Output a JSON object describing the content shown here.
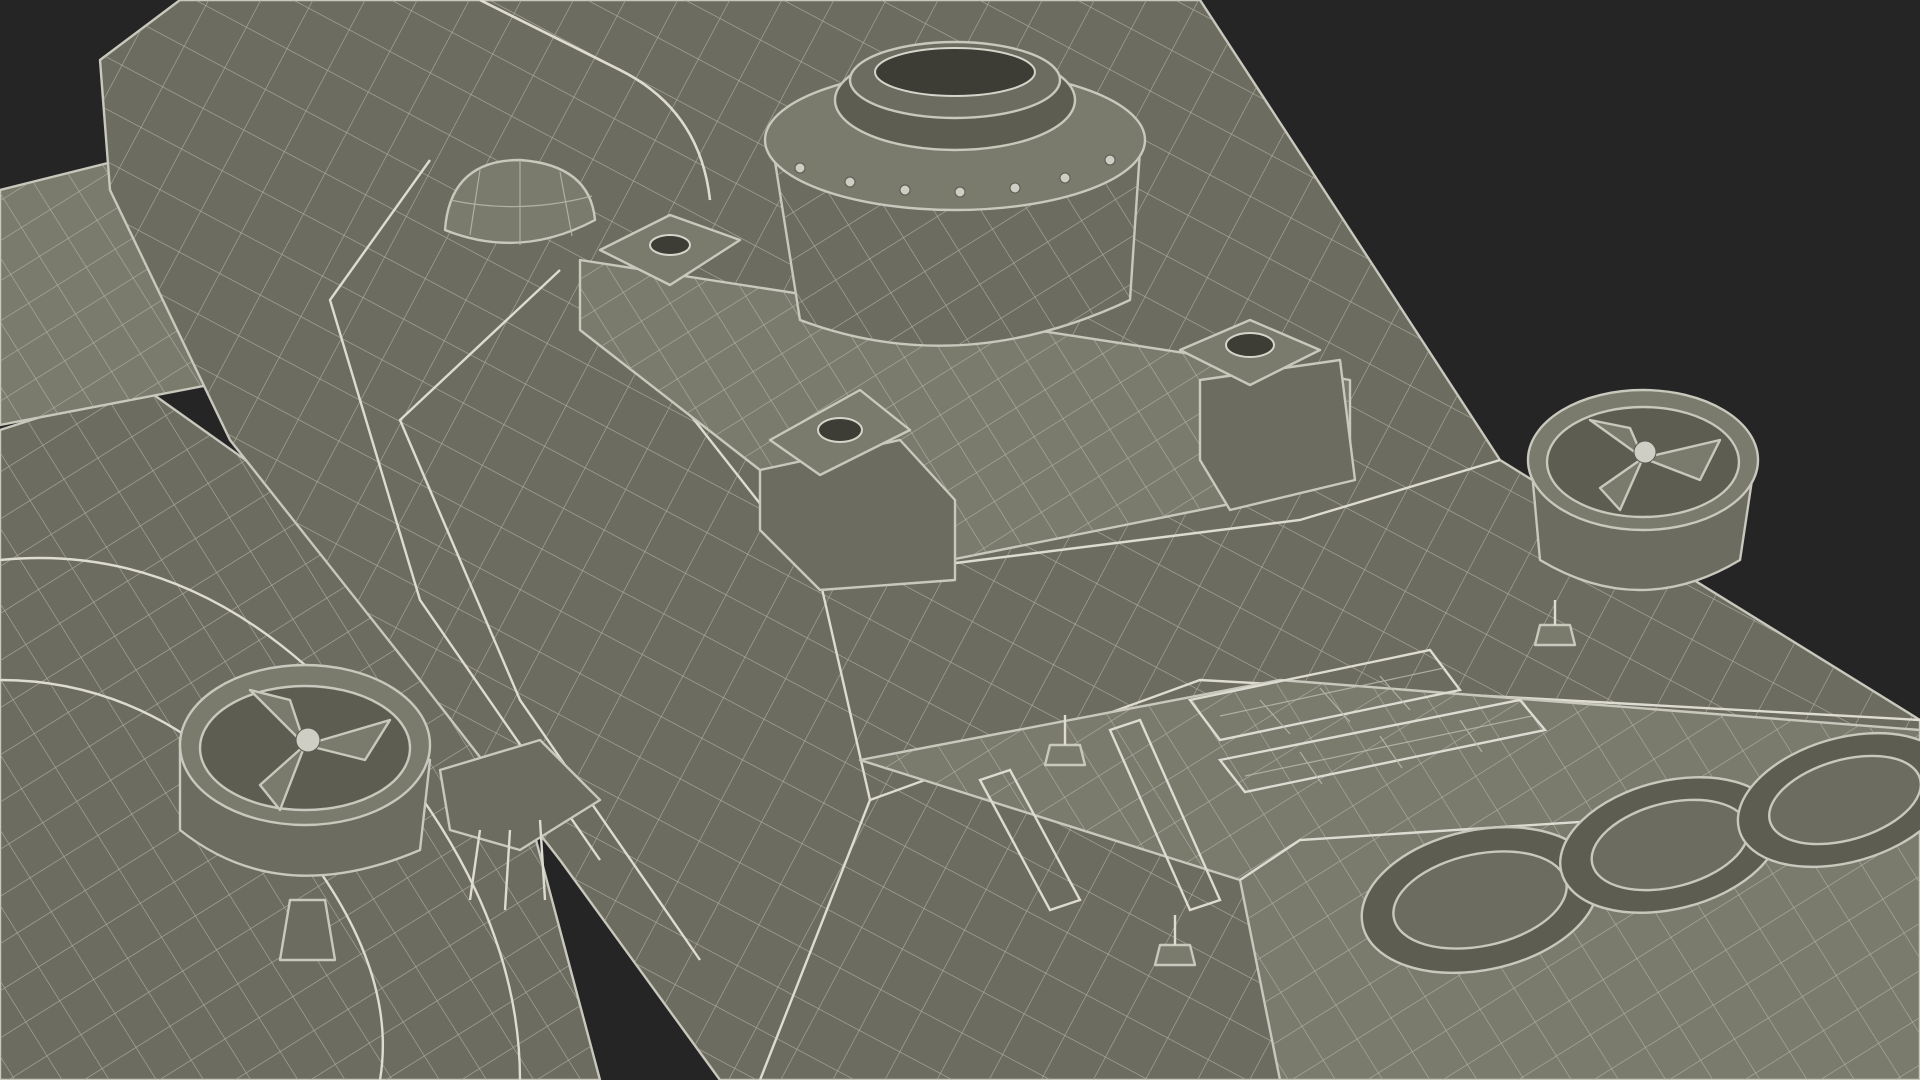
{
  "scene": {
    "background_color": "#252525",
    "mesh_fill_color": "#6d6c60",
    "wire_color": "#c9c8bd"
  }
}
